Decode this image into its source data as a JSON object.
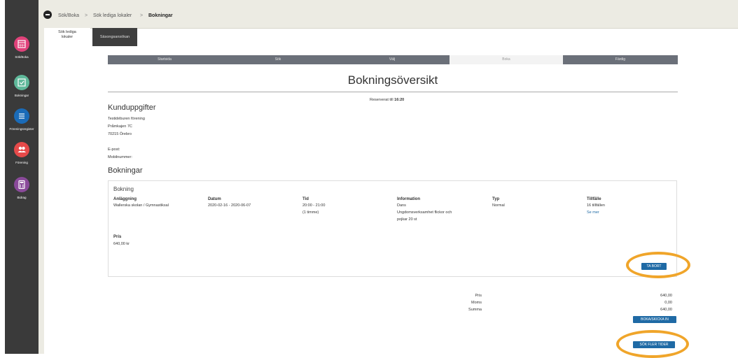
{
  "breadcrumb": {
    "item1": "Sök/Boka",
    "sep1": ">",
    "item2": "Sök lediga lokaler",
    "sep2": ">",
    "item3": "Bokningar"
  },
  "tabs": {
    "active_line1": "Sök lediga",
    "active_line2": "lokaler",
    "second": "Säsongsansökan"
  },
  "sidebar": {
    "items": [
      {
        "label": "Sök/Boka",
        "icon": "calendar-icon",
        "color": "#e0427a"
      },
      {
        "label": "Bokningar",
        "icon": "calendar-check-icon",
        "color": "#5fb89a"
      },
      {
        "label": "Föreningsregister",
        "icon": "list-icon",
        "color": "#1a6bb8"
      },
      {
        "label": "Förening",
        "icon": "people-icon",
        "color": "#e64a4a"
      },
      {
        "label": "Bidrag",
        "icon": "calculator-icon",
        "color": "#8a4a9a"
      }
    ]
  },
  "steps": [
    "Startsida",
    "Sök",
    "Välj",
    "Boka",
    "Färdig"
  ],
  "page_title": "Bokningsöversikt",
  "reserved": {
    "label": "Reserverat till",
    "time": "16:20"
  },
  "customer": {
    "heading": "Kunduppgifter",
    "name": "Testidéburen förening",
    "street": "Pråmkajen 7C",
    "city": "70215 Örebro",
    "email_label": "E-post:",
    "phone_label": "Mobilnummer:"
  },
  "bookings_heading": "Bokningar",
  "booking": {
    "title": "Bokning",
    "headers": {
      "facility": "Anläggning",
      "date": "Datum",
      "time": "Tid",
      "info": "Information",
      "type": "Typ",
      "occasion": "Tillfälle"
    },
    "facility": "Wallerska skolan / Gymnastiksal",
    "date": "2020-02-16 - 2020-06-07",
    "time": "20:00 - 21:00",
    "duration": "(1 timme)",
    "info_line1": "Dans",
    "info_line2": "Ungdomsverksamhet flickor och",
    "info_line3": "pojkar 20 st",
    "type": "Normal",
    "occasions": "16 tillfällen",
    "see_more": "Se mer",
    "price_label": "Pris",
    "price": "640,00 kr",
    "remove_button": "TA BORT"
  },
  "summary": {
    "price_label": "Pris",
    "price": "640,00",
    "vat_label": "Moms",
    "vat": "0,00",
    "total_label": "Summa",
    "total": "640,00",
    "submit_button": "BOKA/SKICKA IN",
    "search_more_button": "SÖK FLER TIDER"
  },
  "colors": {
    "accent": "#1f6aa5",
    "highlight_ring": "#f0a52a",
    "step_bar": "#6b7079"
  }
}
